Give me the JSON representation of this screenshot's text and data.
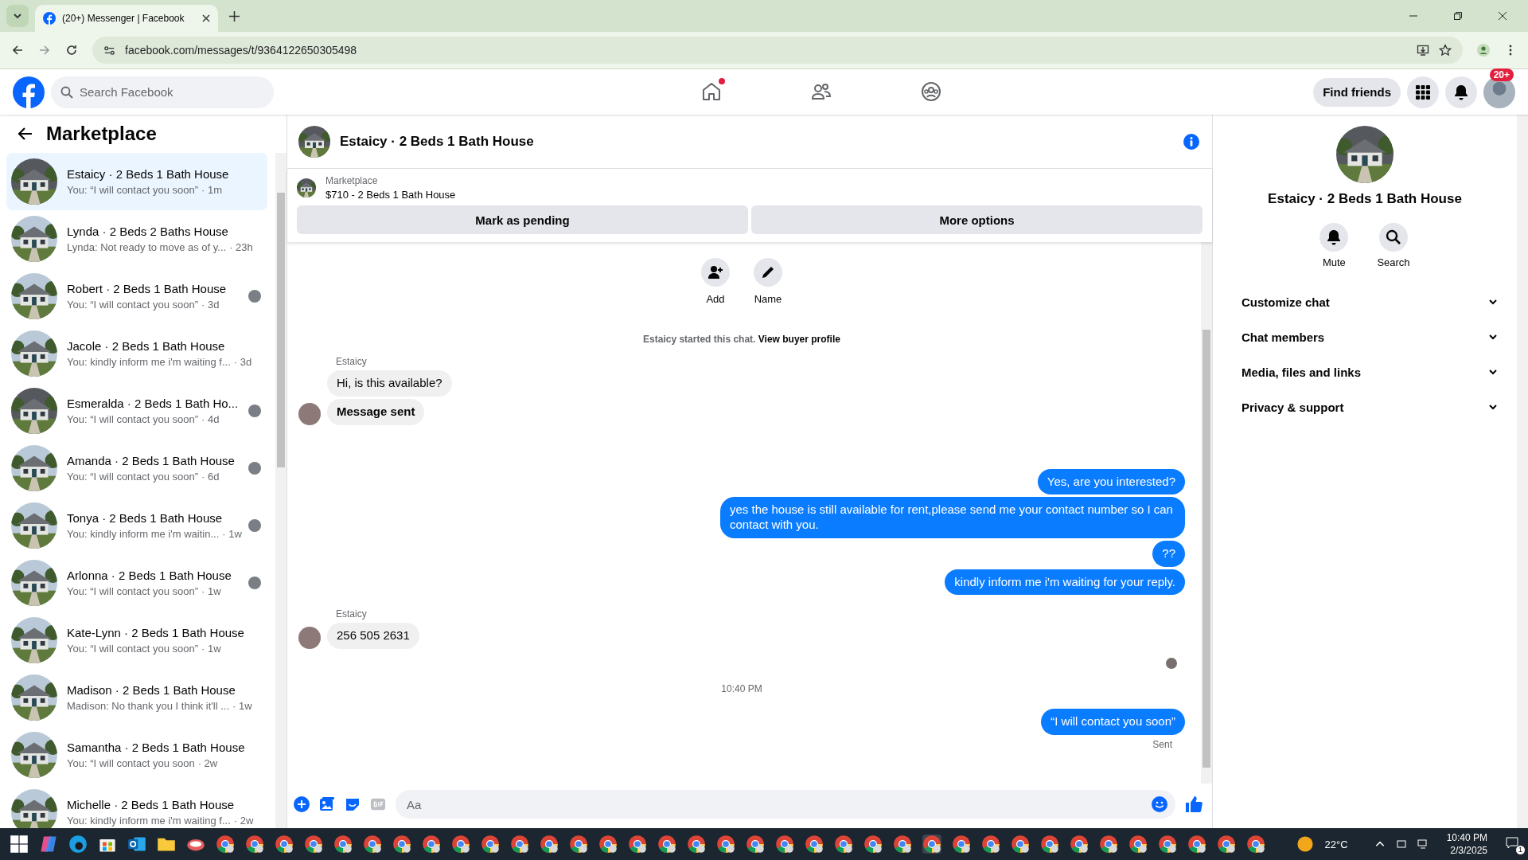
{
  "browser": {
    "tab_title": "(20+) Messenger | Facebook",
    "url": "facebook.com/messages/t/9364122650305498"
  },
  "header": {
    "search_placeholder": "Search Facebook",
    "nav": [
      {
        "kind": "home",
        "dot": true
      },
      {
        "kind": "friends",
        "dot": false
      },
      {
        "kind": "groups",
        "dot": false
      }
    ],
    "find_friends": "Find friends",
    "notification_count": "20+"
  },
  "sidebar": {
    "title": "Marketplace",
    "items": [
      {
        "name": "Estaicy · 2 Beds 1 Bath House",
        "snippet": "You: “I will contact you soon”",
        "time": "· 1m",
        "selected": true,
        "seen": false
      },
      {
        "name": "Lynda · 2 Beds 2 Baths House",
        "snippet": "Lynda: Not ready to move as of y...",
        "time": "· 23h",
        "selected": false,
        "seen": false
      },
      {
        "name": "Robert · 2 Beds 1 Bath House",
        "snippet": "You: “I will contact you soon”",
        "time": "· 3d",
        "selected": false,
        "seen": true
      },
      {
        "name": "Jacole · 2 Beds 1 Bath House",
        "snippet": "You: kindly inform me i'm waiting f...",
        "time": "· 3d",
        "selected": false,
        "seen": false
      },
      {
        "name": "Esmeralda · 2 Beds 1 Bath Ho...",
        "snippet": "You: “I will contact you soon”",
        "time": "· 4d",
        "selected": false,
        "seen": true
      },
      {
        "name": "Amanda · 2 Beds 1 Bath House",
        "snippet": "You: “I will contact you soon”",
        "time": "· 6d",
        "selected": false,
        "seen": true
      },
      {
        "name": "Tonya · 2 Beds 1 Bath House",
        "snippet": "You: kindly inform me i'm waitin...",
        "time": "· 1w",
        "selected": false,
        "seen": true
      },
      {
        "name": "Arlonna · 2 Beds 1 Bath House",
        "snippet": "You: “I will contact you soon”",
        "time": "· 1w",
        "selected": false,
        "seen": true
      },
      {
        "name": "Kate-Lynn · 2 Beds 1 Bath House",
        "snippet": "You: “I will contact you soon”",
        "time": "· 1w",
        "selected": false,
        "seen": false
      },
      {
        "name": "Madison · 2 Beds 1 Bath House",
        "snippet": "Madison: No thank you I think it'll ...",
        "time": "· 1w",
        "selected": false,
        "seen": false
      },
      {
        "name": "Samantha · 2 Beds 1 Bath House",
        "snippet": "You: “I will contact you soon",
        "time": "· 2w",
        "selected": false,
        "seen": false
      },
      {
        "name": "Michelle · 2 Beds 1 Bath House",
        "snippet": "You: kindly inform me i'm waiting f...",
        "time": "· 2w",
        "selected": false,
        "seen": false
      }
    ]
  },
  "chat": {
    "title": "Estaicy · 2 Beds 1 Bath House",
    "listing": {
      "label": "Marketplace",
      "summary": "$710 - 2 Beds 1 Bath House"
    },
    "actions": [
      "Mark as pending",
      "More options"
    ],
    "quick_actions": [
      {
        "kind": "add",
        "label": "Add"
      },
      {
        "kind": "name",
        "label": "Name"
      }
    ],
    "started": {
      "text": "Estaicy started this chat.",
      "link": "View buyer profile"
    },
    "timeline": [
      {
        "kind": "sender",
        "text": "Estaicy"
      },
      {
        "kind": "incoming",
        "text": "Hi, is this available?",
        "avatar": false,
        "bold": false
      },
      {
        "kind": "incoming",
        "text": "Message sent",
        "avatar": true,
        "bold": true
      },
      {
        "kind": "outgoing",
        "text": "Yes, are you interested?"
      },
      {
        "kind": "outgoing",
        "text": "yes the house is still available for rent,please send me your contact number so I can contact with you."
      },
      {
        "kind": "outgoing",
        "text": "??"
      },
      {
        "kind": "outgoing",
        "text": "kindly inform me i'm waiting for your reply."
      },
      {
        "kind": "sender",
        "text": "Estaicy"
      },
      {
        "kind": "incoming",
        "text": "256 505 2631",
        "avatar": true,
        "bold": false
      },
      {
        "kind": "seen"
      },
      {
        "kind": "timestamp",
        "text": "10:40 PM"
      },
      {
        "kind": "outgoing",
        "text": "“I will contact you soon”"
      },
      {
        "kind": "status",
        "text": "Sent"
      }
    ],
    "composer": {
      "placeholder": "Aa"
    }
  },
  "details": {
    "title": "Estaicy · 2 Beds 1 Bath House",
    "actions": [
      {
        "kind": "mute",
        "label": "Mute"
      },
      {
        "kind": "search",
        "label": "Search"
      }
    ],
    "sections": [
      "Customize chat",
      "Chat members",
      "Media, files and links",
      "Privacy & support"
    ]
  },
  "taskbar": {
    "weather": "22°C",
    "time": "10:40 PM",
    "date": "2/3/2025",
    "notifications": "1"
  }
}
